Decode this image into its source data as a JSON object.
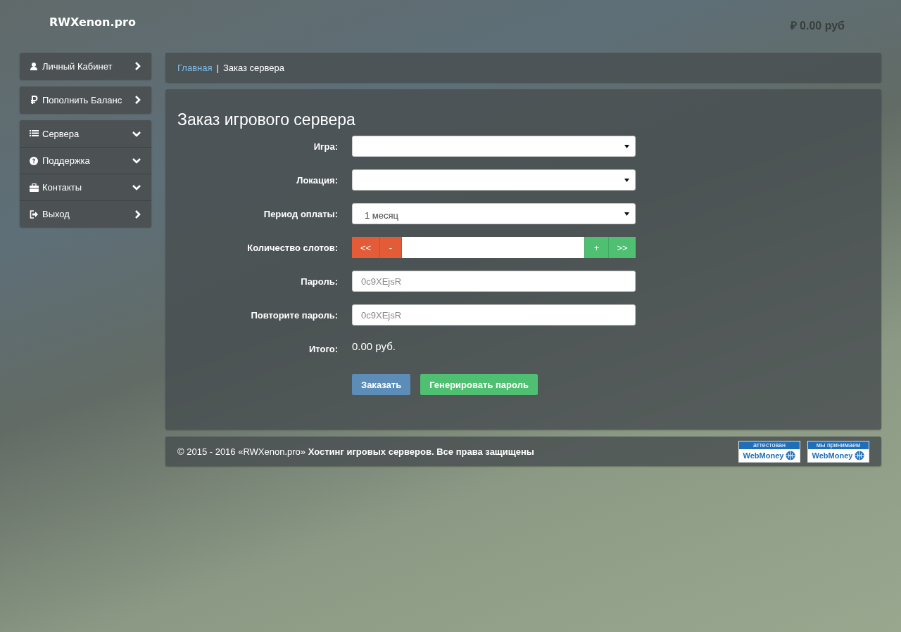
{
  "header": {
    "logo": "RWXenon.pro",
    "balance": "₽ 0.00 руб"
  },
  "sidebar": {
    "groups": [
      {
        "items": [
          {
            "label": "Личный Кабинет",
            "kind": "link"
          }
        ]
      },
      {
        "items": [
          {
            "label": "Пополнить Баланс",
            "kind": "link"
          }
        ]
      },
      {
        "items": [
          {
            "label": "Сервера",
            "kind": "dropdown"
          },
          {
            "label": "Поддержка",
            "kind": "dropdown"
          },
          {
            "label": "Контакты",
            "kind": "dropdown"
          },
          {
            "label": "Выход",
            "kind": "link"
          }
        ]
      }
    ]
  },
  "breadcrumb": {
    "link": "Главная",
    "separator": "|",
    "current": "Заказ сервера"
  },
  "form": {
    "title": "Заказ игрового сервера",
    "rows": [
      {
        "label": "Игра:",
        "kind": "select"
      },
      {
        "label": "Локация:",
        "kind": "select"
      },
      {
        "label": "Период оплаты:",
        "kind": "select",
        "value": "1 месяц"
      },
      {
        "label": "Количество слотов:",
        "kind": "stepper",
        "buttons": [
          "<<",
          "-",
          "+",
          ">>"
        ]
      },
      {
        "label": "Пароль:",
        "kind": "password",
        "placeholder": "0c9XEjsR"
      },
      {
        "label": "Повторите пароль:",
        "kind": "password",
        "placeholder": "0c9XEjsR"
      },
      {
        "label": "Итого:",
        "kind": "total",
        "value": "0.00 руб."
      }
    ],
    "buttons": [
      {
        "label": "Заказать",
        "kind": "primary"
      },
      {
        "label": "Генерировать пароль",
        "kind": "success"
      }
    ]
  },
  "footer": {
    "text": "© 2015 - 2016 «RWXenon.pro» **Хостинг игровых серверов. Все права защищены**",
    "badges": [
      {
        "top": "аттестован",
        "brand": "WebMoney"
      },
      {
        "top": "мы принимаем",
        "brand": "WebMoney"
      }
    ]
  }
}
